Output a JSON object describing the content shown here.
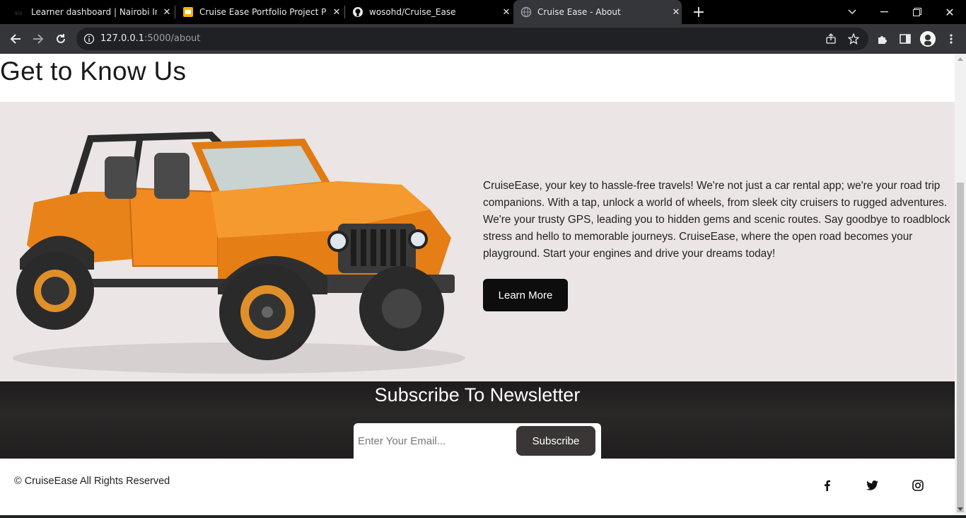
{
  "browser": {
    "tabs": [
      {
        "title": "Learner dashboard | Nairobi Intr",
        "favicon": "alx-icon",
        "active": false
      },
      {
        "title": "Cruise Ease Portfolio Project Pre",
        "favicon": "slides-icon",
        "active": false
      },
      {
        "title": "wosohd/Cruise_Ease",
        "favicon": "github-icon",
        "active": false
      },
      {
        "title": "Cruise Ease - About",
        "favicon": "globe-icon",
        "active": true
      }
    ],
    "url_host": "127.0.0.1",
    "url_path": ":5000/about"
  },
  "page": {
    "heading": "Get to Know Us",
    "about_text": "CruiseEase, your key to hassle-free travels! We're not just a car rental app; we're your road trip companions. With a tap, unlock a world of wheels, from sleek city cruisers to rugged adventures. We're your trusty GPS, leading you to hidden gems and scenic routes. Say goodbye to roadblock stress and hello to memorable journeys. CruiseEase, where the open road becomes your playground. Start your engines and drive your dreams today!",
    "learn_more_label": "Learn More",
    "newsletter": {
      "title": "Subscribe To Newsletter",
      "email_placeholder": "Enter Your Email...",
      "subscribe_label": "Subscribe"
    },
    "footer": {
      "copyright": "© CruiseEase All Rights Reserved",
      "social": [
        "facebook-icon",
        "twitter-icon",
        "instagram-icon"
      ]
    }
  },
  "colors": {
    "about_bg": "#ebe5e5",
    "jeep_body": "#f28a1f",
    "button_dark": "#0d0d0d",
    "newsletter_bg": "#2b2828"
  }
}
